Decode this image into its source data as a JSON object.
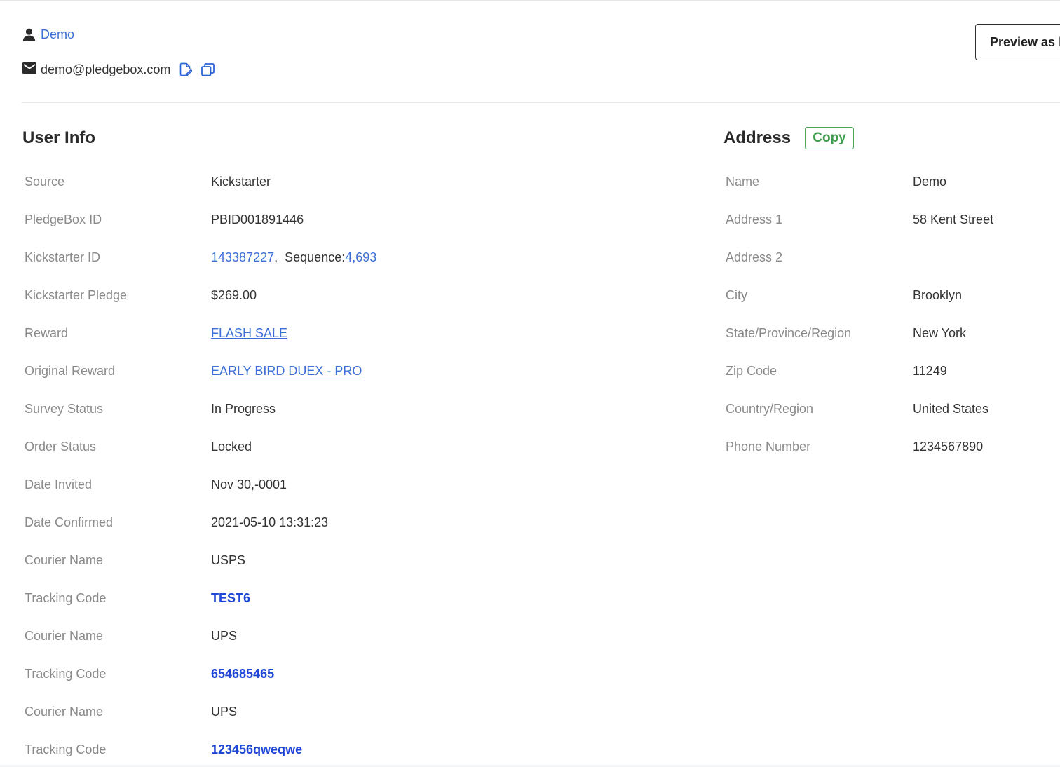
{
  "header": {
    "user_name": "Demo",
    "email": "demo@pledgebox.com",
    "preview_button_label": "Preview as backer"
  },
  "user_info": {
    "title": "User Info",
    "rows": [
      {
        "label": "Source",
        "value": "Kickstarter"
      },
      {
        "label": "PledgeBox ID",
        "value": "PBID001891446"
      },
      {
        "label": "Kickstarter ID",
        "kickstarter_id": "143387227",
        "separator": ",",
        "sequence_label": "Sequence:",
        "sequence_value": "4,693"
      },
      {
        "label": "Kickstarter Pledge",
        "value": "$269.00"
      },
      {
        "label": "Reward",
        "value": "FLASH SALE"
      },
      {
        "label": "Original Reward",
        "value": "EARLY BIRD DUEX - PRO"
      },
      {
        "label": "Survey Status",
        "value": "In Progress"
      },
      {
        "label": "Order Status",
        "value": "Locked"
      },
      {
        "label": "Date Invited",
        "value": "Nov 30,-0001"
      },
      {
        "label": "Date Confirmed",
        "value": "2021-05-10 13:31:23"
      },
      {
        "label": "Courier Name",
        "value": "USPS"
      },
      {
        "label": "Tracking Code",
        "value": "TEST6"
      },
      {
        "label": "Courier Name",
        "value": "UPS"
      },
      {
        "label": "Tracking Code",
        "value": "654685465"
      },
      {
        "label": "Courier Name",
        "value": "UPS"
      },
      {
        "label": "Tracking Code",
        "value": "123456qweqwe"
      }
    ]
  },
  "address": {
    "title": "Address",
    "copy_label": "Copy",
    "rows": [
      {
        "label": "Name",
        "value": "Demo"
      },
      {
        "label": "Address 1",
        "value": "58 Kent Street"
      },
      {
        "label": "Address 2",
        "value": ""
      },
      {
        "label": "City",
        "value": "Brooklyn"
      },
      {
        "label": "State/Province/Region",
        "value": "New York"
      },
      {
        "label": "Zip Code",
        "value": "11249"
      },
      {
        "label": "Country/Region",
        "value": "United States"
      },
      {
        "label": "Phone Number",
        "value": "1234567890"
      }
    ]
  },
  "colors": {
    "link": "#3b6fd6",
    "tracking_link": "#1f47d6",
    "copy_button": "#3f9d50",
    "label": "#8a8a8a"
  },
  "icons": {
    "user": "user-icon",
    "email": "envelope-icon",
    "edit": "edit-icon",
    "copy": "copy-icon"
  }
}
